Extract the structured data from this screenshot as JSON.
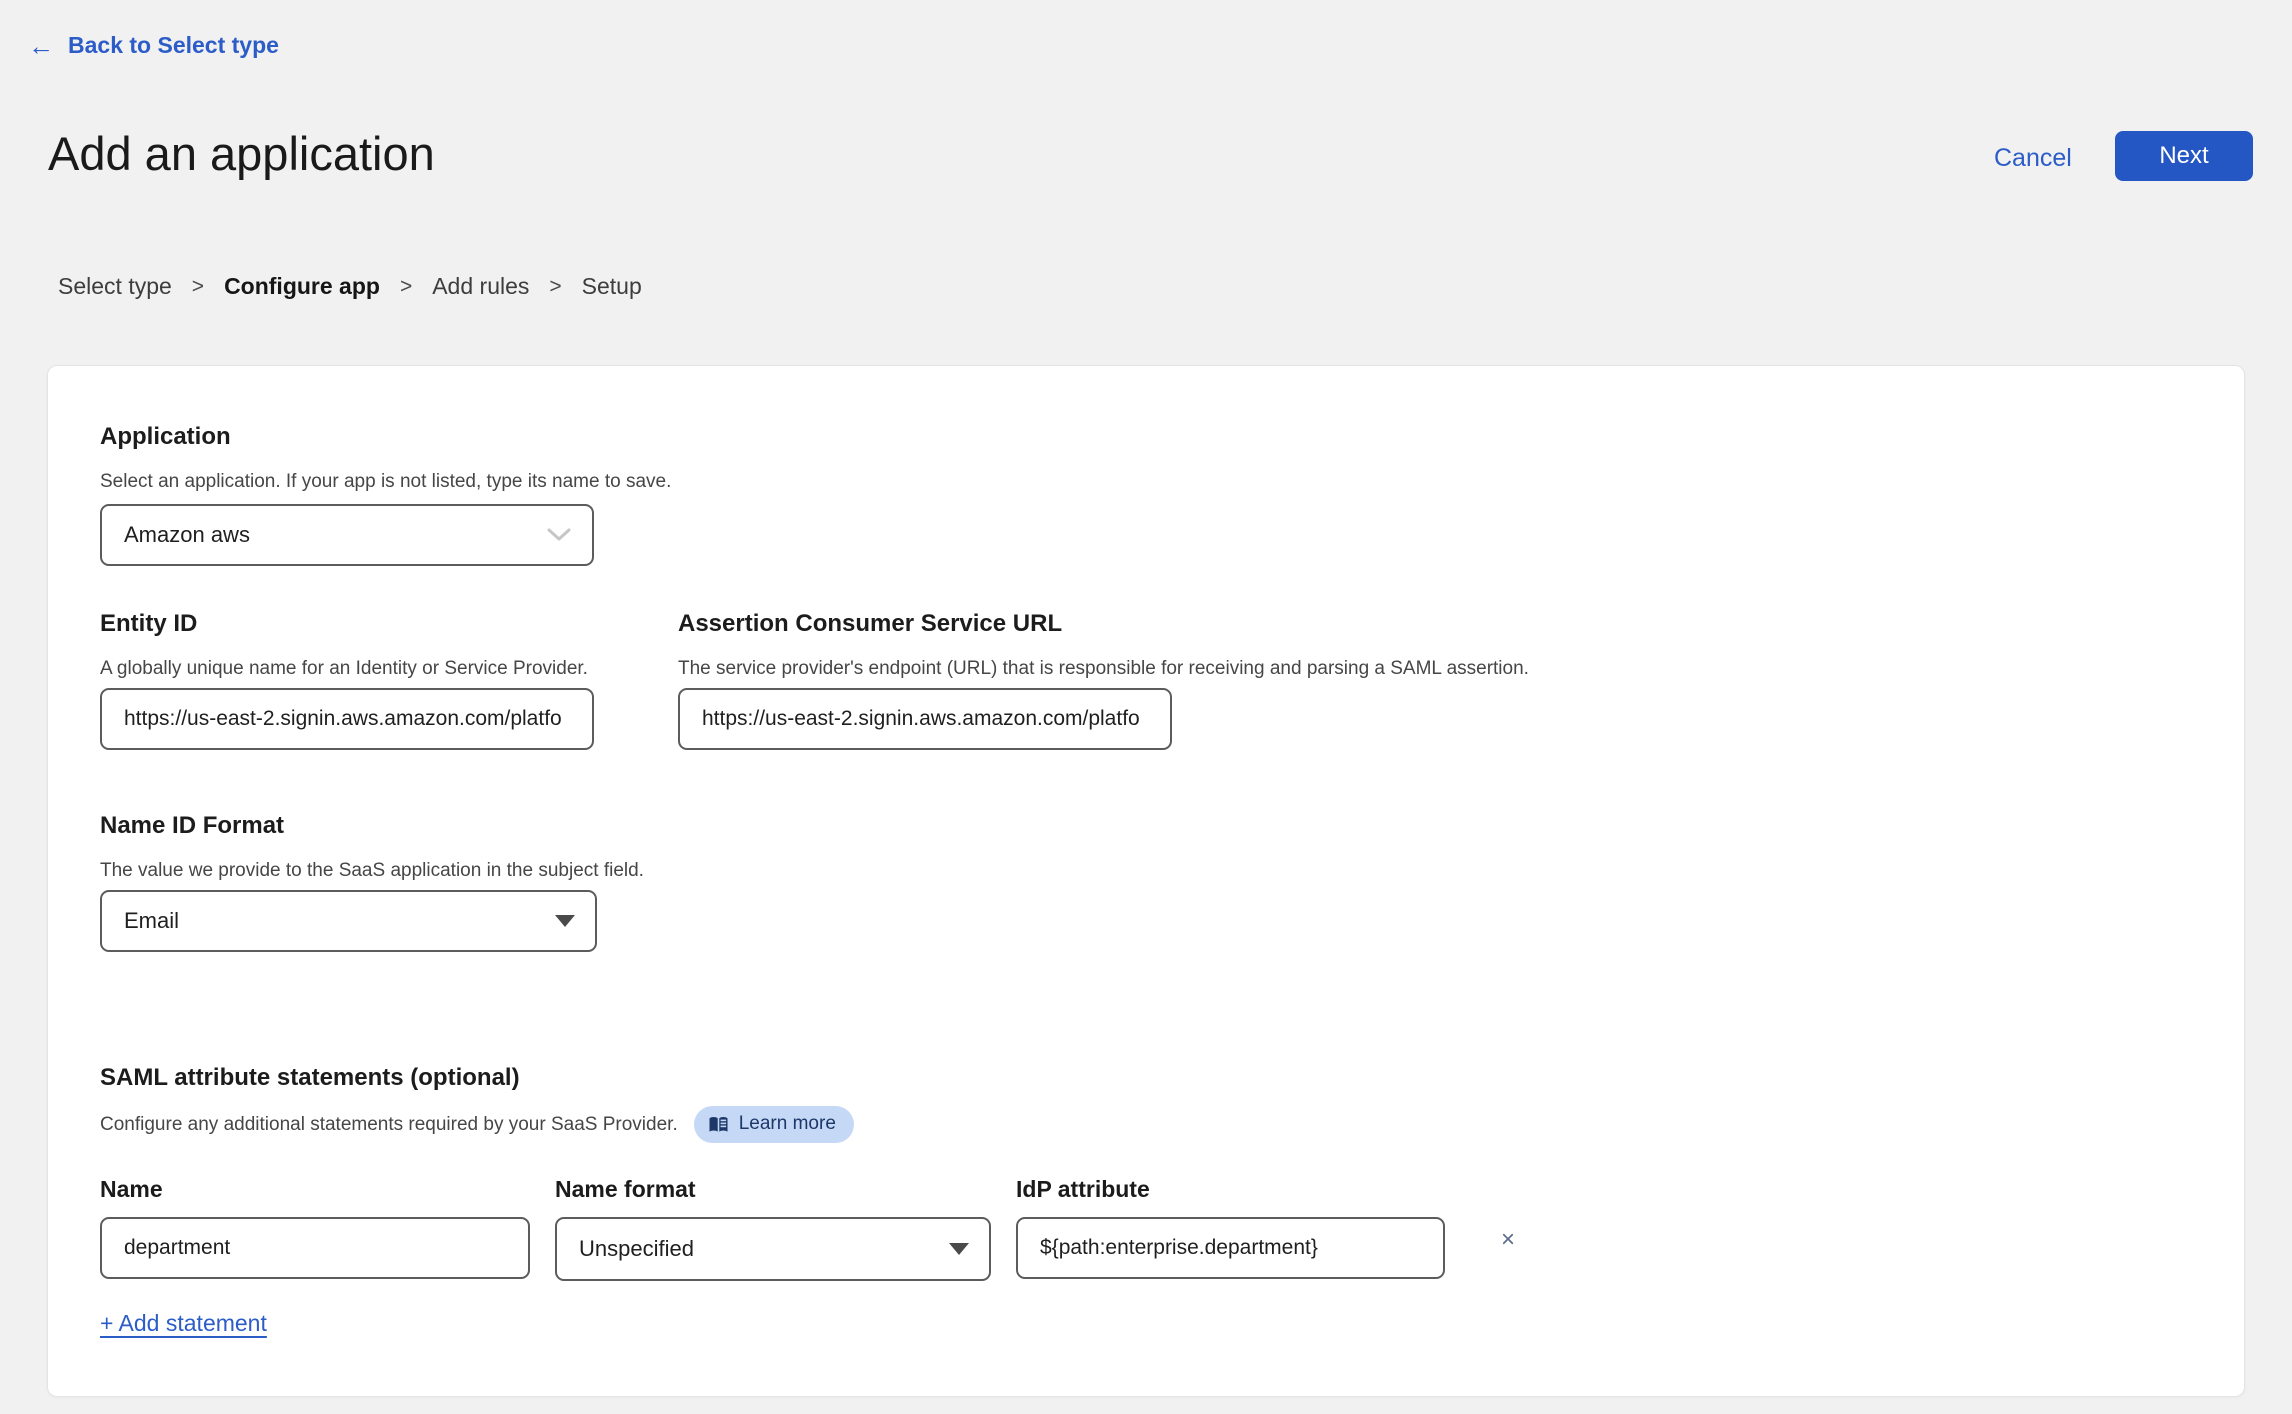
{
  "header": {
    "back_arrow": "←",
    "back_label": "Back to Select type",
    "title": "Add an application",
    "cancel_label": "Cancel",
    "next_label": "Next"
  },
  "breadcrumb": {
    "separator": ">",
    "steps": [
      {
        "label": "Select type"
      },
      {
        "label": "Configure app"
      },
      {
        "label": "Add rules"
      },
      {
        "label": "Setup"
      }
    ]
  },
  "form": {
    "application": {
      "heading": "Application",
      "description": "Select an application. If your app is not listed, type its name to save.",
      "value": "Amazon aws"
    },
    "entity_id": {
      "heading": "Entity ID",
      "description": "A globally unique name for an Identity or Service Provider.",
      "value": "https://us-east-2.signin.aws.amazon.com/platfo"
    },
    "acs_url": {
      "heading": "Assertion Consumer Service URL",
      "description": "The service provider's endpoint (URL) that is responsible for receiving and parsing a SAML assertion.",
      "value": "https://us-east-2.signin.aws.amazon.com/platfo"
    },
    "name_id_format": {
      "heading": "Name ID Format",
      "description": "The value we provide to the SaaS application in the subject field.",
      "value": "Email"
    },
    "saml": {
      "heading": "SAML attribute statements (optional)",
      "description": "Configure any additional statements required by your SaaS Provider.",
      "learn_more_label": "Learn more",
      "columns": {
        "name": "Name",
        "name_format": "Name format",
        "idp_attribute": "IdP attribute"
      },
      "statements": [
        {
          "name": "department",
          "name_format": "Unspecified",
          "idp_attribute": "${path:enterprise.department}"
        }
      ],
      "remove_label": "×",
      "add_statement_label": "+ Add statement"
    }
  },
  "colors": {
    "accent_blue": "#2456c4",
    "link_blue": "#2b5cc8",
    "badge_background": "#c5d8f6",
    "badge_text": "#1d3769",
    "page_background": "#f1f1f1"
  }
}
